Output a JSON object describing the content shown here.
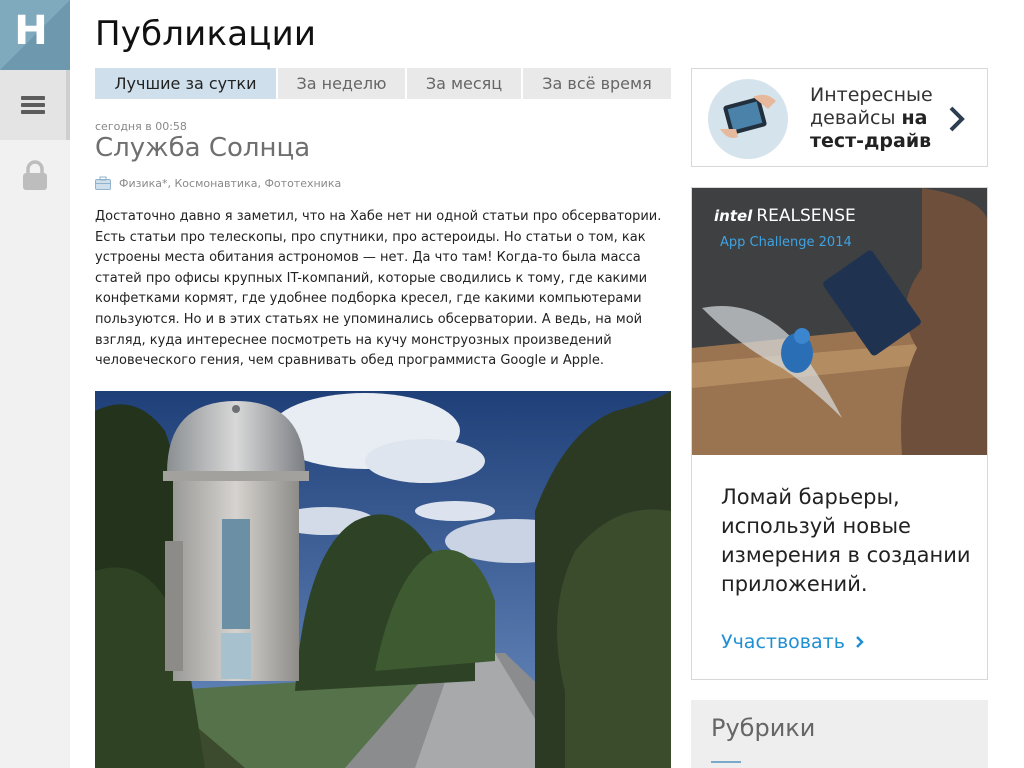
{
  "logo": {
    "letter": "H",
    "color": "#7fa9bd"
  },
  "nav": {
    "icons": [
      "hamburger-menu-icon",
      "lock-icon"
    ]
  },
  "page": {
    "title": "Публикации"
  },
  "tabs": [
    {
      "label": "Лучшие за сутки",
      "active": true
    },
    {
      "label": "За неделю",
      "active": false
    },
    {
      "label": "За месяц",
      "active": false
    },
    {
      "label": "За всё время",
      "active": false
    }
  ],
  "post": {
    "time": "сегодня в 00:58",
    "title": "Служба Солнца",
    "hubs": "Физика*, Космонавтика, Фототехника",
    "body": "Достаточно давно я заметил, что на Хабе нет ни одной статьи про обсерватории. Есть статьи про телескопы, про спутники, про астероиды. Но статьи о том, как устроены места обитания астрономов — нет. Да что там! Когда-то была масса статей про офисы крупных IT-компаний, которые сводились к тому, где какими конфетками кормят, где удобнее подборка кресел, где какими компьютерами пользуются. Но и в этих статьях не упоминались обсерватории. А ведь, на мой взгляд, куда интереснее посмотреть на кучу монструозных произведений человеческого гения, чем сравнивать обед программиста Google и Apple."
  },
  "promo": {
    "line1": "Интересные",
    "line2_prefix": "девайсы ",
    "line2_bold": "на",
    "line3_bold": "тест-драйв"
  },
  "ad": {
    "brand_intel": "intel",
    "brand_name": "REALSENSE",
    "subtitle": "App Challenge 2014",
    "copy": "Ломай барьеры, используй новые измерения в создании приложений.",
    "cta": "Участвовать",
    "accent_color": "#1f8fd3"
  },
  "rubrics": {
    "title": "Рубрики"
  }
}
